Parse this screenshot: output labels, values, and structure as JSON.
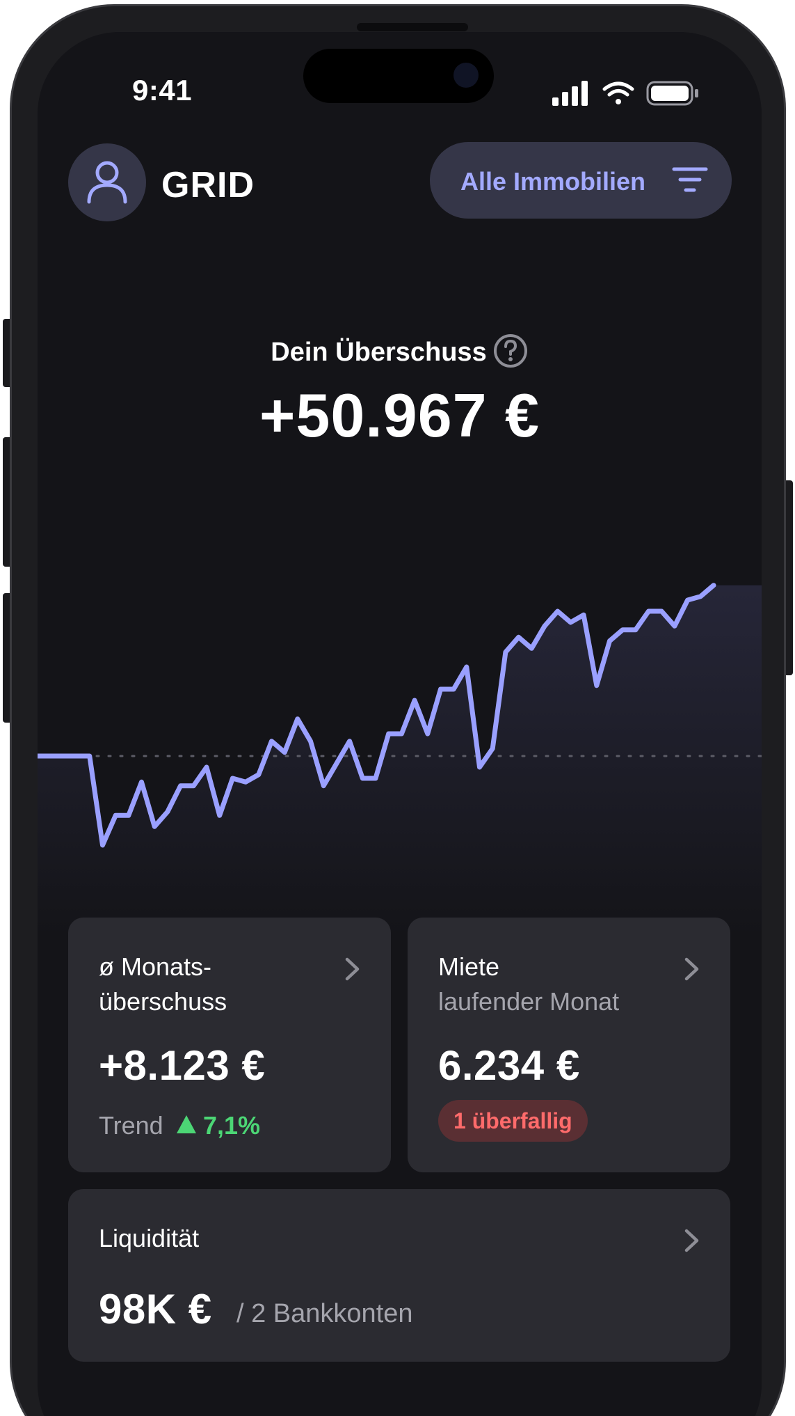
{
  "status": {
    "time": "9:41",
    "icons": [
      "cellular-signal-icon",
      "wifi-icon",
      "battery-icon"
    ]
  },
  "header": {
    "app_name": "GRID",
    "avatar_icon": "user-icon",
    "filter": {
      "label": "Alle Immobilien",
      "icon": "filter-icon"
    }
  },
  "summary": {
    "title": "Dein Überschuss",
    "help_icon": "help-icon",
    "amount": "+50.967 €"
  },
  "chart_data": {
    "type": "line",
    "values": [
      0,
      0,
      0,
      0,
      0,
      -24,
      -16,
      -16,
      -7,
      -19,
      -15,
      -8,
      -8,
      -3,
      -16,
      -6,
      -7,
      -5,
      4,
      1,
      10,
      4,
      -8,
      -2,
      4,
      -6,
      -6,
      6,
      6,
      15,
      6,
      18,
      18,
      24,
      -3,
      2,
      28,
      32,
      29,
      35,
      39,
      36,
      38,
      19,
      31,
      34,
      34,
      39,
      39,
      35,
      42,
      43,
      46
    ],
    "baseline": 0,
    "grid": false,
    "line_color": "#9aa0ff"
  },
  "cards": {
    "monthly": {
      "title": "ø Monats-",
      "title_line2": "überschuss",
      "value": "+8.123 €",
      "trend_label": "Trend",
      "trend_value": "7,1%",
      "trend_color": "#4cd675"
    },
    "rent": {
      "title": "Miete",
      "subtitle": "laufender Monat",
      "value": "6.234 €",
      "badge": "1 überfallig",
      "badge_color": "#ff6b6b"
    },
    "liquidity": {
      "title": "Liquidität",
      "value": "98K €",
      "suffix": "/ 2 Bankkonten"
    }
  },
  "colors": {
    "accent": "#a3aaff",
    "background": "#141418",
    "card": "#2b2b31"
  }
}
